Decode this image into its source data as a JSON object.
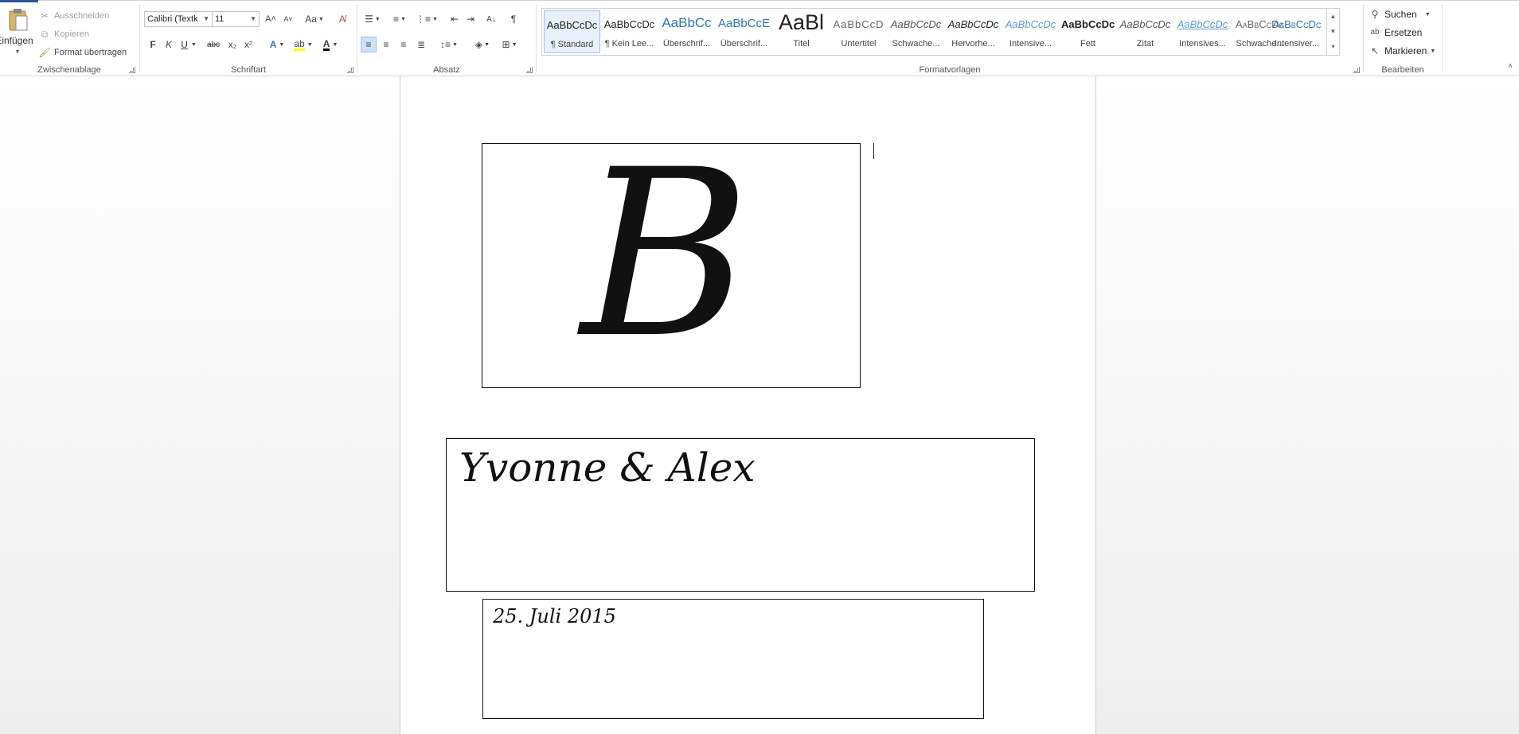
{
  "clipboard": {
    "paste_label": "Einfügen",
    "cut_label": "Ausschneiden",
    "copy_label": "Kopieren",
    "format_painter_label": "Format übertragen",
    "group_label": "Zwischenablage"
  },
  "font": {
    "family_value": "Calibri (Textk",
    "size_value": "11",
    "bold_label": "F",
    "italic_label": "K",
    "underline_label": "U",
    "strike_label": "abc",
    "subscript_label": "x₂",
    "superscript_label": "x²",
    "grow_label": "A˄",
    "shrink_label": "A˅",
    "case_label": "Aa",
    "group_label": "Schriftart"
  },
  "paragraph": {
    "group_label": "Absatz"
  },
  "styles": {
    "group_label": "Formatvorlagen",
    "items": [
      {
        "sample": "AaBbCcDc",
        "name": "¶ Standard"
      },
      {
        "sample": "AaBbCcDc",
        "name": "¶ Kein Lee..."
      },
      {
        "sample": "AaBbCc",
        "name": "Überschrif..."
      },
      {
        "sample": "AaBbCcE",
        "name": "Überschrif..."
      },
      {
        "sample": "AaBl",
        "name": "Titel"
      },
      {
        "sample": "AaBbCcD",
        "name": "Untertitel"
      },
      {
        "sample": "AaBbCcDc",
        "name": "Schwache..."
      },
      {
        "sample": "AaBbCcDc",
        "name": "Hervorhe..."
      },
      {
        "sample": "AaBbCcDc",
        "name": "Intensive..."
      },
      {
        "sample": "AaBbCcDc",
        "name": "Fett"
      },
      {
        "sample": "AaBbCcDc",
        "name": "Zitat"
      },
      {
        "sample": "AaBbCcDc",
        "name": "Intensives..."
      },
      {
        "sample": "AaBbCcDc",
        "name": "Schwache..."
      },
      {
        "sample": "AaBbCcDc",
        "name": "Intensiver..."
      }
    ]
  },
  "editing": {
    "find_label": "Suchen",
    "replace_label": "Ersetzen",
    "select_label": "Markieren",
    "group_label": "Bearbeiten"
  },
  "document": {
    "monogram": "B",
    "names": "Yvonne & Alex",
    "date": "25. Juli 2015"
  },
  "colors": {
    "accent": "#2b579a",
    "highlight": "#ffff00",
    "font_color": "#000000",
    "style_blue": "#2e74b5"
  }
}
